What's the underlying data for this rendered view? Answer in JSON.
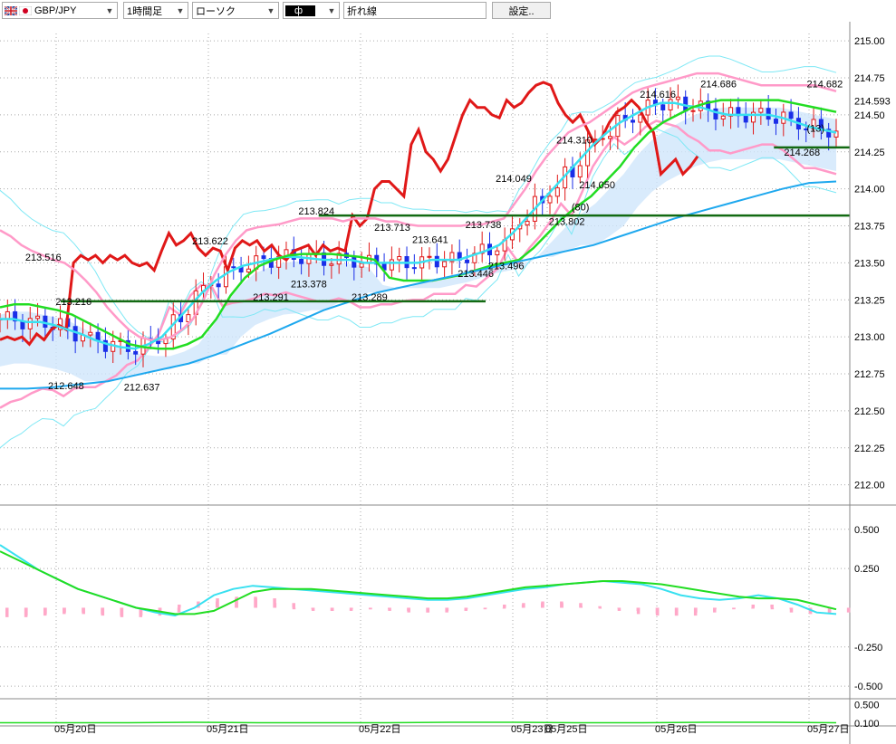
{
  "toolbar": {
    "symbol": "GBP/JPY",
    "interval": "1時間足",
    "chart_type": "ローソク",
    "indicator": "ф",
    "line_type": "折れ線",
    "settings_label": "設定..",
    "flag_colors": {
      "gb_blue": "#1d3c8f",
      "gb_red": "#cc1b22",
      "jp_red": "#d00020"
    }
  },
  "chart_data": [
    {
      "type": "candlestick",
      "title": "",
      "ylim": [
        211.9,
        215.05
      ],
      "y_ticks": [
        "215.00",
        "214.75",
        "214.50",
        "214.25",
        "214.00",
        "213.75",
        "213.50",
        "213.25",
        "213.00",
        "212.75",
        "212.50",
        "212.25",
        "212.00"
      ],
      "x_ticks": [
        "05月20日",
        "05月21日",
        "05月22日",
        "05月23日",
        "05月25日",
        "05月26日",
        "05月27日"
      ],
      "current_price_label": "214.593",
      "annotations": [
        {
          "label": "213.516",
          "x": 5,
          "y": 213.54
        },
        {
          "label": "213.216",
          "x": 9,
          "y": 213.24
        },
        {
          "label": "212.648",
          "x": 8,
          "y": 212.67
        },
        {
          "label": "212.637",
          "x": 18,
          "y": 212.66
        },
        {
          "label": "213.622",
          "x": 27,
          "y": 213.65
        },
        {
          "label": "213.291",
          "x": 35,
          "y": 213.27
        },
        {
          "label": "213.378",
          "x": 40,
          "y": 213.36
        },
        {
          "label": "213.824",
          "x": 41,
          "y": 213.85
        },
        {
          "label": "213.713",
          "x": 51,
          "y": 213.74
        },
        {
          "label": "213.289",
          "x": 48,
          "y": 213.27
        },
        {
          "label": "213.641",
          "x": 56,
          "y": 213.66
        },
        {
          "label": "213.446",
          "x": 62,
          "y": 213.43
        },
        {
          "label": "213.738",
          "x": 63,
          "y": 213.76
        },
        {
          "label": "213.496",
          "x": 66,
          "y": 213.48
        },
        {
          "label": "214.049",
          "x": 67,
          "y": 214.07
        },
        {
          "label": "213.802",
          "x": 74,
          "y": 213.78
        },
        {
          "label": "214.310",
          "x": 75,
          "y": 214.33
        },
        {
          "label": "214.050",
          "x": 78,
          "y": 214.03
        },
        {
          "label": "(80)",
          "x": 77,
          "y": 213.88
        },
        {
          "label": "214.616",
          "x": 86,
          "y": 214.64
        },
        {
          "label": "214.686",
          "x": 94,
          "y": 214.71
        },
        {
          "label": "214.268",
          "x": 105,
          "y": 214.25
        },
        {
          "label": "(13)",
          "x": 108,
          "y": 214.41
        },
        {
          "label": "214.682",
          "x": 108,
          "y": 214.71
        }
      ],
      "horizontal_lines": [
        {
          "y": 213.24,
          "x1": 8,
          "x2": 64
        },
        {
          "y": 213.82,
          "x1": 42,
          "x2": 112
        },
        {
          "y": 214.28,
          "x1": 102,
          "x2": 112
        }
      ],
      "series": [
        {
          "name": "",
          "color": "#e01818",
          "role": "parabolic-line",
          "values": [
            212.98,
            213.0,
            212.98,
            213.0,
            212.95,
            213.02,
            212.98,
            213.05,
            213.08,
            213.05,
            213.5,
            213.55,
            213.52,
            213.55,
            213.5,
            213.55,
            213.52,
            213.55,
            213.5,
            213.48,
            213.5,
            213.45,
            213.58,
            213.7,
            213.62,
            213.65,
            213.7,
            213.6,
            213.55,
            213.6,
            213.58,
            213.45,
            213.6,
            213.65,
            213.62,
            213.65,
            213.58,
            213.62,
            213.55,
            213.52,
            213.58,
            213.6,
            213.62,
            213.55,
            213.62,
            213.58,
            213.6,
            213.58,
            213.82,
            213.75,
            213.8,
            214.0,
            214.05,
            214.05,
            214.0,
            213.95,
            214.3,
            214.4,
            214.25,
            214.2,
            214.12,
            214.2,
            214.35,
            214.5,
            214.6,
            214.55,
            214.55,
            214.5,
            214.48,
            214.6,
            214.55,
            214.58,
            214.65,
            214.7,
            214.72,
            214.7,
            214.58,
            214.5,
            214.45,
            214.5,
            214.4,
            214.3,
            214.35,
            214.45,
            214.52,
            214.55,
            214.6,
            214.55,
            214.45,
            214.38,
            214.1,
            214.15,
            214.2,
            214.1,
            214.15,
            214.22
          ]
        },
        {
          "name": "",
          "color": "#ff9ac8",
          "role": "bb-upper-2",
          "values": [
            213.72,
            213.68,
            213.62,
            213.58,
            213.55,
            213.52,
            213.5,
            213.45,
            213.38,
            213.3,
            213.2,
            213.12,
            213.05,
            213.0,
            212.98,
            212.98,
            213.0,
            213.05,
            213.12,
            213.25,
            213.42,
            213.55,
            213.65,
            213.72,
            213.74,
            213.75,
            213.76,
            213.78,
            213.8,
            213.8,
            213.8,
            213.8,
            213.78,
            213.8,
            213.8,
            213.8,
            213.78,
            213.78,
            213.76,
            213.75,
            213.75,
            213.75,
            213.75,
            213.75,
            213.76,
            213.76,
            213.78,
            213.8,
            213.9,
            214.0,
            214.12,
            214.22,
            214.3,
            214.38,
            214.42,
            214.45,
            214.5,
            214.55,
            214.6,
            214.65,
            214.68,
            214.7,
            214.72,
            214.74,
            214.76,
            214.78,
            214.78,
            214.78,
            214.76,
            214.74,
            214.72,
            214.7,
            214.7,
            214.7,
            214.7,
            214.7,
            214.7,
            214.68,
            214.66
          ]
        },
        {
          "name": "",
          "color": "#38e0f0",
          "role": "ma-short",
          "values": [
            213.12,
            213.12,
            213.1,
            213.1,
            213.08,
            213.05,
            213.02,
            212.98,
            212.95,
            212.93,
            212.92,
            212.95,
            213.0,
            213.1,
            213.2,
            213.3,
            213.38,
            213.44,
            213.48,
            213.5,
            213.52,
            213.54,
            213.54,
            213.53,
            213.52,
            213.52,
            213.52,
            213.5,
            213.5,
            213.5,
            213.5,
            213.5,
            213.52,
            213.52,
            213.52,
            213.55,
            213.58,
            213.62,
            213.7,
            213.8,
            213.9,
            214.0,
            214.1,
            214.2,
            214.3,
            214.38,
            214.45,
            214.5,
            214.55,
            214.58,
            214.58,
            214.56,
            214.55,
            214.52,
            214.5,
            214.5,
            214.5,
            214.5,
            214.48,
            214.45,
            214.42,
            214.4,
            214.38
          ]
        },
        {
          "name": "",
          "color": "#22dd22",
          "role": "ma-mid",
          "values": [
            213.2,
            213.22,
            213.22,
            213.2,
            213.18,
            213.15,
            213.1,
            213.05,
            213.0,
            212.95,
            212.93,
            212.92,
            212.92,
            212.95,
            213.0,
            213.12,
            213.28,
            213.4,
            213.48,
            213.52,
            213.55,
            213.56,
            213.56,
            213.56,
            213.55,
            213.54,
            213.52,
            213.4,
            213.38,
            213.38,
            213.38,
            213.4,
            213.42,
            213.45,
            213.48,
            213.5,
            213.52,
            213.6,
            213.7,
            213.8,
            213.88,
            213.95,
            214.05,
            214.15,
            214.28,
            214.38,
            214.45,
            214.5,
            214.55,
            214.58,
            214.6,
            214.6,
            214.6,
            214.6,
            214.6,
            214.58,
            214.56,
            214.54,
            214.52
          ]
        },
        {
          "name": "",
          "color": "#1ea8ee",
          "role": "ma-long",
          "values": [
            212.65,
            212.65,
            212.66,
            212.68,
            212.7,
            212.74,
            212.78,
            212.82,
            212.88,
            212.95,
            213.02,
            213.1,
            213.18,
            213.24,
            213.3,
            213.34,
            213.38,
            213.42,
            213.46,
            213.5,
            213.54,
            213.58,
            213.62,
            213.68,
            213.74,
            213.8,
            213.85,
            213.9,
            213.95,
            214.0,
            214.04,
            214.05
          ]
        }
      ]
    },
    {
      "type": "line",
      "title": "",
      "ylim": [
        -0.58,
        0.62
      ],
      "y_ticks": [
        "0.500",
        "0.250",
        "-0.250",
        "-0.500"
      ],
      "series": [
        {
          "name": "",
          "color": "#38e0f0",
          "values": [
            0.4,
            0.32,
            0.24,
            0.18,
            0.12,
            0.08,
            0.04,
            0.0,
            -0.03,
            -0.05,
            0.0,
            0.08,
            0.12,
            0.14,
            0.13,
            0.12,
            0.11,
            0.1,
            0.09,
            0.08,
            0.07,
            0.06,
            0.05,
            0.05,
            0.06,
            0.08,
            0.1,
            0.12,
            0.13,
            0.15,
            0.16,
            0.17,
            0.16,
            0.15,
            0.12,
            0.08,
            0.06,
            0.05,
            0.06,
            0.08,
            0.06,
            0.02,
            -0.03,
            -0.04
          ]
        },
        {
          "name": "",
          "color": "#22dd22",
          "values": [
            0.36,
            0.3,
            0.24,
            0.18,
            0.12,
            0.08,
            0.04,
            0.0,
            -0.02,
            -0.04,
            -0.04,
            -0.02,
            0.04,
            0.1,
            0.12,
            0.12,
            0.12,
            0.11,
            0.1,
            0.09,
            0.08,
            0.07,
            0.06,
            0.06,
            0.07,
            0.09,
            0.11,
            0.13,
            0.14,
            0.15,
            0.16,
            0.17,
            0.17,
            0.16,
            0.15,
            0.13,
            0.11,
            0.09,
            0.07,
            0.06,
            0.06,
            0.05,
            0.02,
            -0.01
          ]
        },
        {
          "name": "",
          "color": "#ffa8c8",
          "role": "histogram",
          "values": [
            -0.06,
            -0.05,
            -0.04,
            -0.03,
            -0.04,
            -0.05,
            -0.06,
            -0.05,
            -0.03,
            0.02,
            0.04,
            0.06,
            0.07,
            0.06,
            0.03,
            -0.01,
            -0.02,
            -0.02,
            -0.01,
            -0.01,
            -0.02,
            -0.03,
            -0.03,
            -0.02,
            -0.01,
            0.0,
            0.02,
            0.03,
            0.04,
            0.03,
            0.01,
            0.0,
            -0.02,
            -0.04,
            -0.05,
            -0.05,
            -0.03,
            -0.01,
            0.0,
            0.02,
            -0.01,
            -0.03,
            -0.04,
            -0.03
          ]
        }
      ]
    },
    {
      "type": "line",
      "title": "",
      "ylim": [
        0.08,
        0.55
      ],
      "y_ticks": [
        "0.500",
        "0.100"
      ],
      "series": [
        {
          "name": "",
          "color": "#22dd22",
          "values": [
            0.11,
            0.11,
            0.11,
            0.12,
            0.11,
            0.11,
            0.11,
            0.12,
            0.12,
            0.11,
            0.11,
            0.12,
            0.12,
            0.11
          ]
        }
      ]
    }
  ]
}
